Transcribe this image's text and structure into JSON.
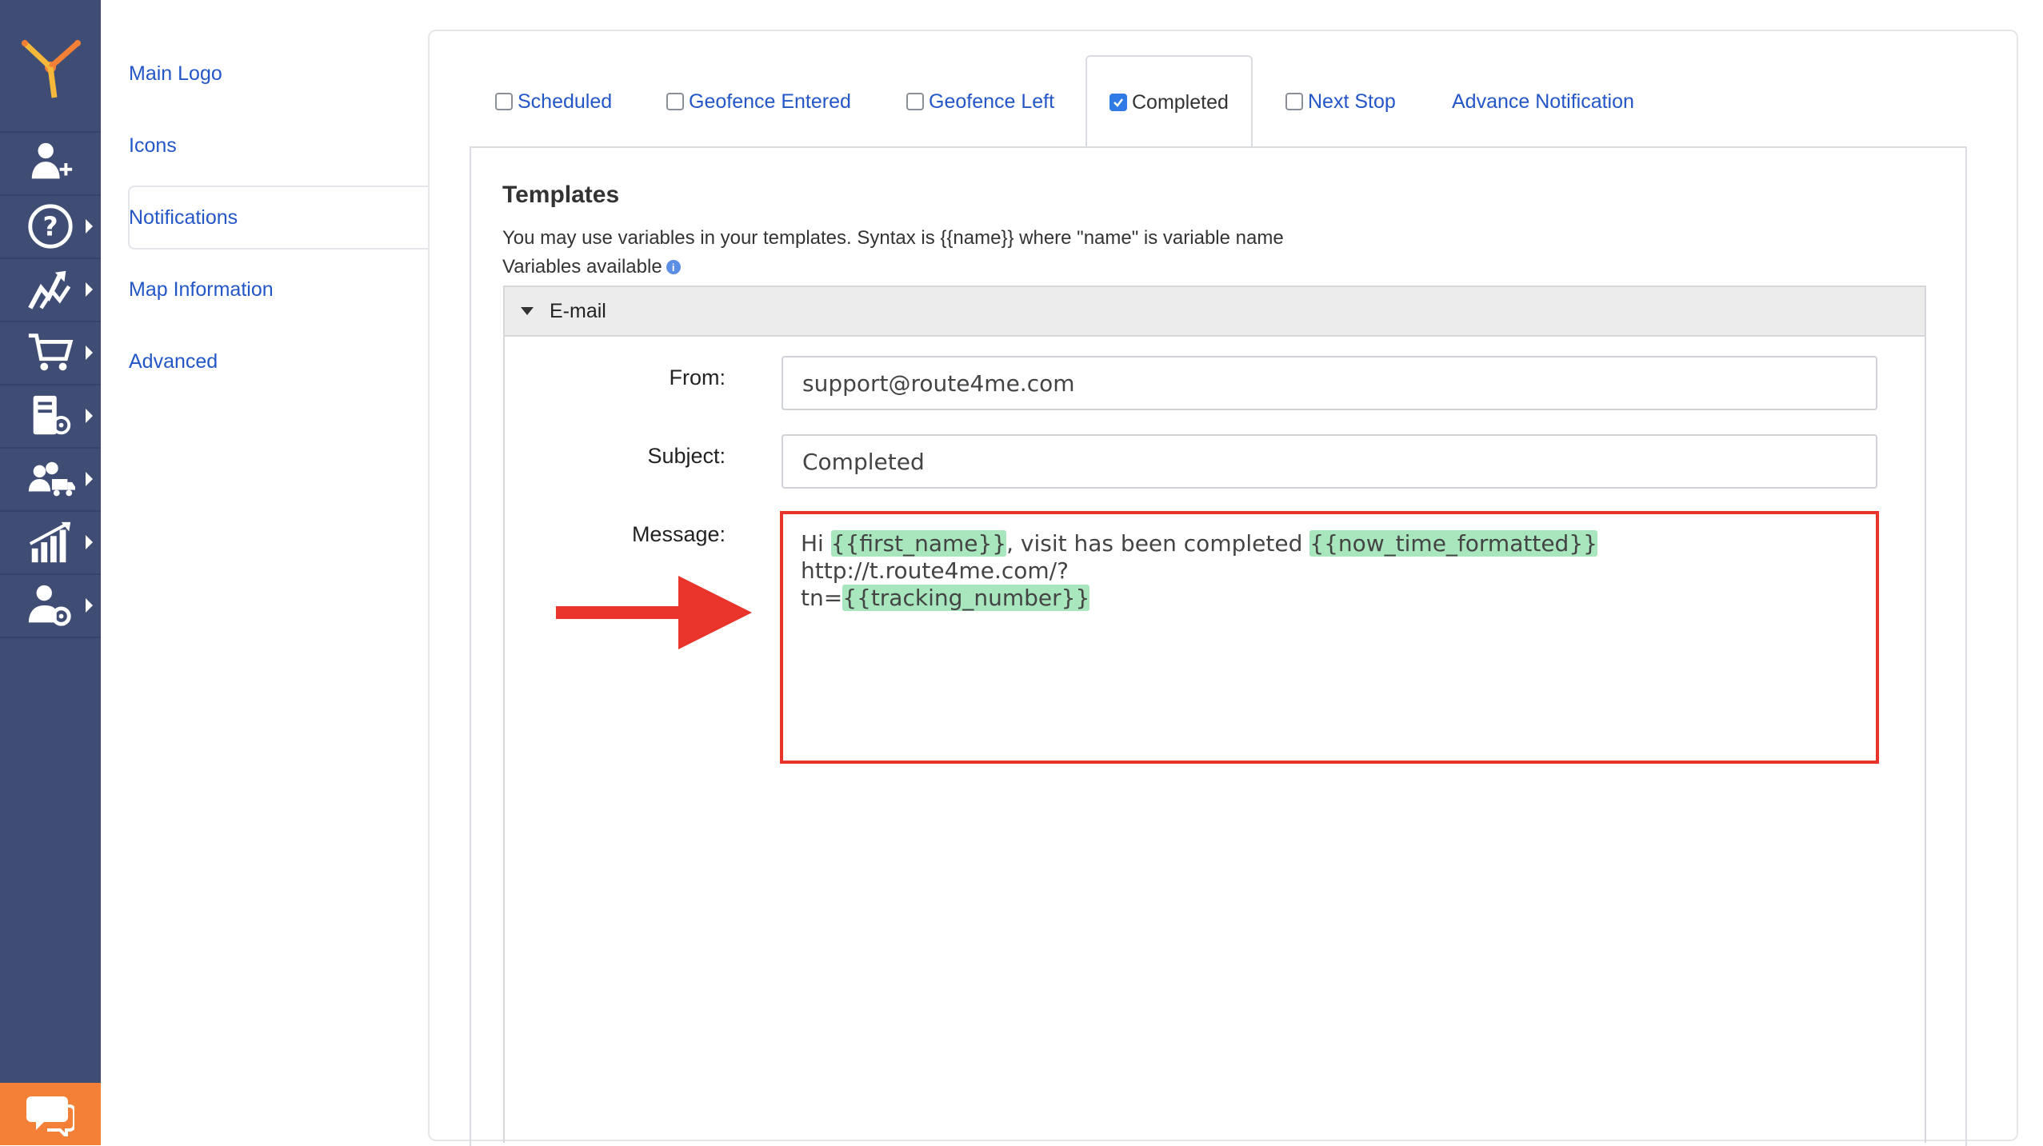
{
  "settings_nav": {
    "items": [
      {
        "label": "Main Logo"
      },
      {
        "label": "Icons"
      },
      {
        "label": "Notifications"
      },
      {
        "label": "Map Information"
      },
      {
        "label": "Advanced"
      }
    ],
    "active_index": 2
  },
  "rail": {
    "icons": [
      "logo-icon",
      "add-user-icon",
      "help-icon",
      "routes-icon",
      "cart-icon",
      "route-planner-icon",
      "team-icon",
      "analytics-icon",
      "user-settings-icon",
      "chat-icon"
    ],
    "accent_color": "#f47f36",
    "background_color": "#3f4c74"
  },
  "tabs": [
    {
      "label": "Scheduled",
      "checked": false,
      "active": false
    },
    {
      "label": "Geofence Entered",
      "checked": false,
      "active": false
    },
    {
      "label": "Geofence Left",
      "checked": false,
      "active": false
    },
    {
      "label": "Completed",
      "checked": true,
      "active": true
    },
    {
      "label": "Next Stop",
      "checked": false,
      "active": false
    },
    {
      "label": "Advance Notification",
      "checked": null,
      "active": false
    }
  ],
  "templates": {
    "title": "Templates",
    "description": "You may use variables in your templates. Syntax is {{name}} where \"name\" is variable name",
    "variables_label": "Variables available",
    "info_icon": "i"
  },
  "email": {
    "section_label": "E-mail",
    "from_label": "From:",
    "from_value": "support@route4me.com",
    "subject_label": "Subject:",
    "subject_value": "Completed",
    "message_label": "Message:",
    "message": {
      "part1": "Hi ",
      "var1": "{{first_name}}",
      "part2": ", visit has been completed ",
      "var2": "{{now_time_formatted}}",
      "part3": "  http://t.route4me.com/?",
      "part4": "tn=",
      "var3": "{{tracking_number}}"
    }
  },
  "colors": {
    "link": "#2356c7",
    "highlight_box": "#e8342a",
    "variable_bg": "#a8e6bd",
    "checkbox_checked": "#2f7ae5"
  }
}
